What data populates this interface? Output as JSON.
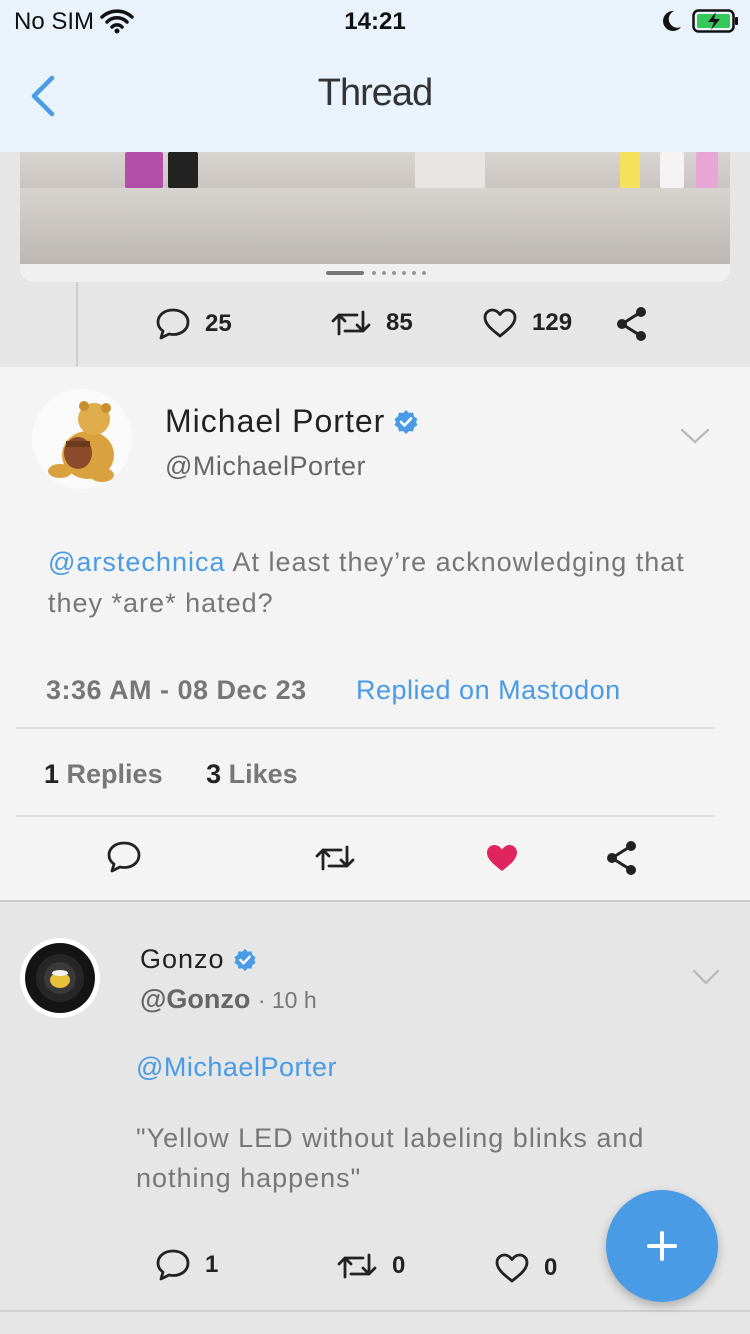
{
  "status_bar": {
    "carrier": "No SIM",
    "time": "14:21"
  },
  "nav": {
    "title": "Thread"
  },
  "top_tweet": {
    "replies": "25",
    "retweets": "85",
    "likes": "129"
  },
  "main_tweet": {
    "name": "Michael Porter",
    "handle": "@MichaelPorter",
    "mention": "@arstechnica",
    "text": " At least they’re acknowledging that they *are* hated?",
    "timestamp": "3:36 AM - 08 Dec 23",
    "via": "Replied on Mastodon",
    "replies_count": "1",
    "replies_label": "Replies",
    "likes_count": "3",
    "likes_label": "Likes",
    "liked": true,
    "like_color": "#e0245e"
  },
  "reply_tweet": {
    "name": "Gonzo",
    "handle": "@Gonzo",
    "age": "· 10 h",
    "mention": "@MichaelPorter",
    "text": "\"Yellow LED without labeling blinks and nothing happens\"",
    "replies": "1",
    "retweets": "0",
    "likes": "0"
  },
  "colors": {
    "accent": "#4a9be5",
    "verified": "#4a9be5",
    "nav_bg": "#eaf3fb"
  }
}
